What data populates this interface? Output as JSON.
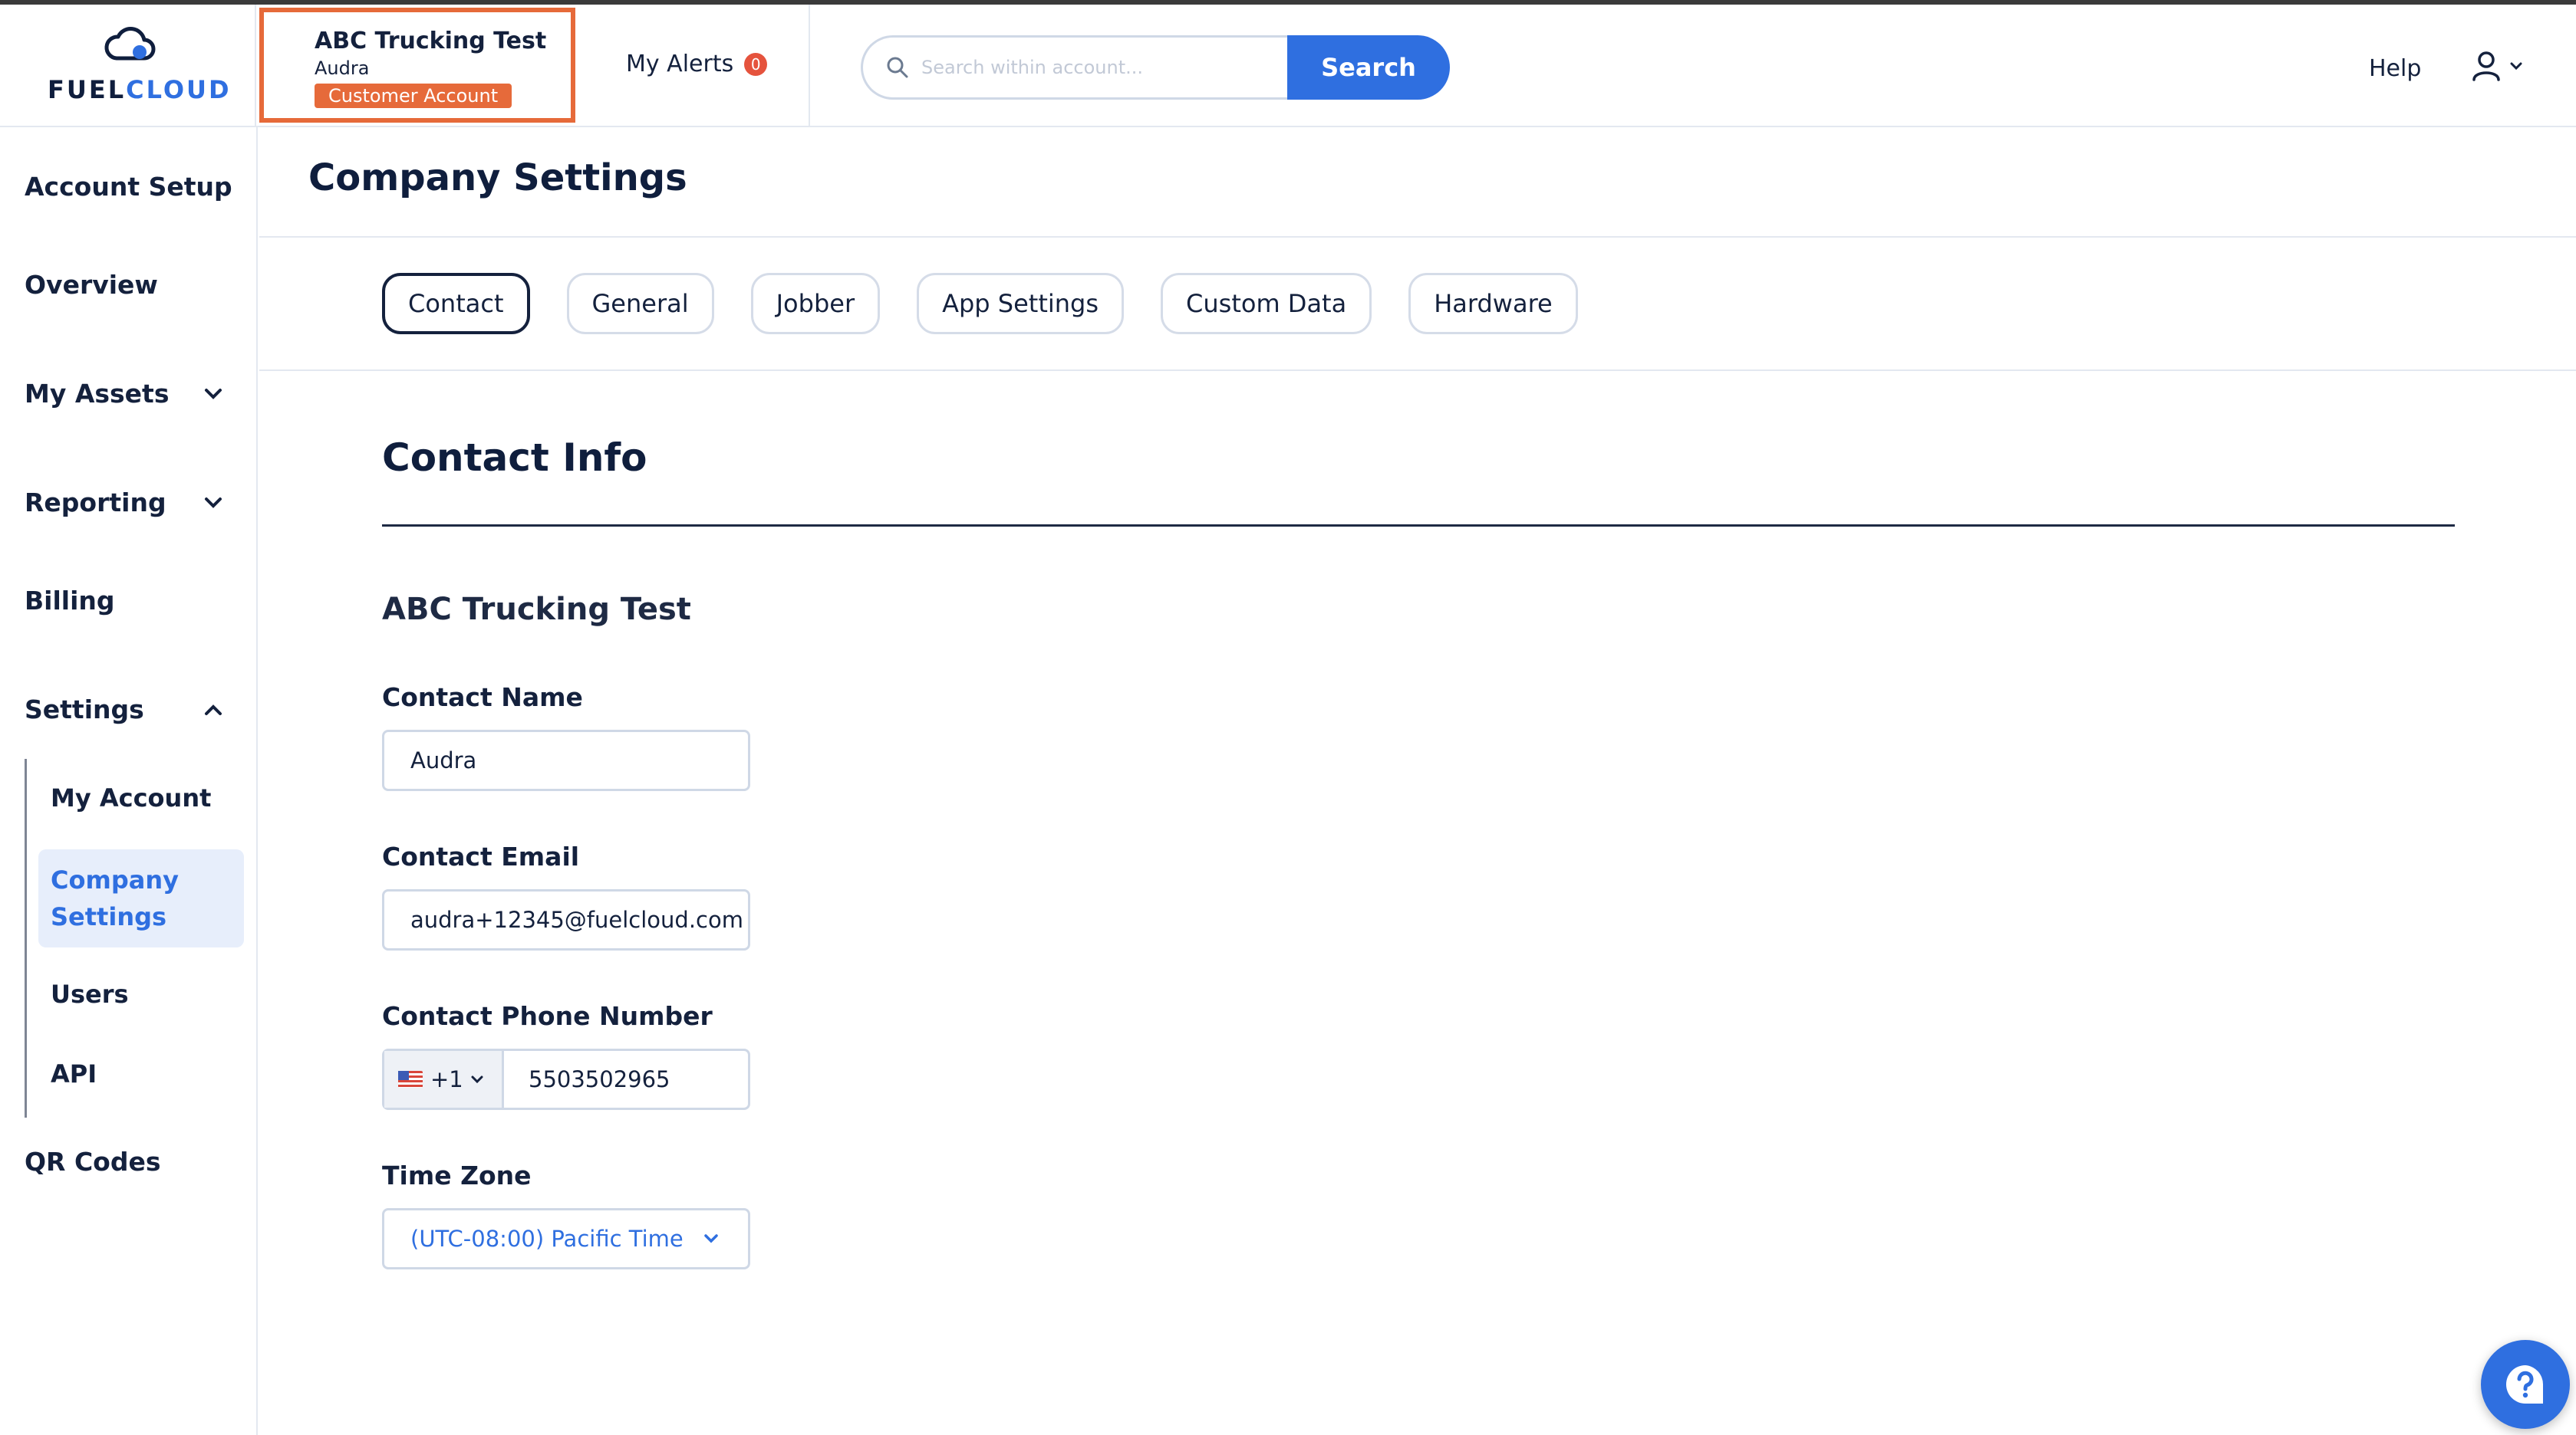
{
  "header": {
    "logo": {
      "part1": "FUEL",
      "part2": "CLOUD"
    },
    "account": {
      "name": "ABC Trucking Test",
      "user": "Audra",
      "badge": "Customer Account"
    },
    "alerts": {
      "label": "My Alerts",
      "count": "0"
    },
    "search": {
      "placeholder": "Search within account...",
      "button": "Search"
    },
    "help": "Help"
  },
  "sidebar": {
    "items": {
      "account_setup": "Account Setup",
      "overview": "Overview",
      "my_assets": "My Assets",
      "reporting": "Reporting",
      "billing": "Billing",
      "settings": "Settings",
      "qr_codes": "QR Codes"
    },
    "settings_sub": {
      "my_account": "My Account",
      "company_settings_line1": "Company",
      "company_settings_line2": "Settings",
      "users": "Users",
      "api": "API"
    }
  },
  "main": {
    "title": "Company Settings",
    "tabs": [
      "Contact",
      "General",
      "Jobber",
      "App Settings",
      "Custom Data",
      "Hardware"
    ],
    "section_title": "Contact Info",
    "company_name": "ABC Trucking Test",
    "fields": {
      "contact_name": {
        "label": "Contact Name",
        "value": "Audra"
      },
      "contact_email": {
        "label": "Contact Email",
        "value": "audra+12345@fuelcloud.com"
      },
      "contact_phone": {
        "label": "Contact Phone Number",
        "country_code": "+1",
        "value": "5503502965"
      },
      "time_zone": {
        "label": "Time Zone",
        "value": "(UTC-08:00) Pacific Time"
      }
    }
  },
  "colors": {
    "accent": "#2f6fe0",
    "highlight": "#e66a3a",
    "text": "#14213d"
  }
}
